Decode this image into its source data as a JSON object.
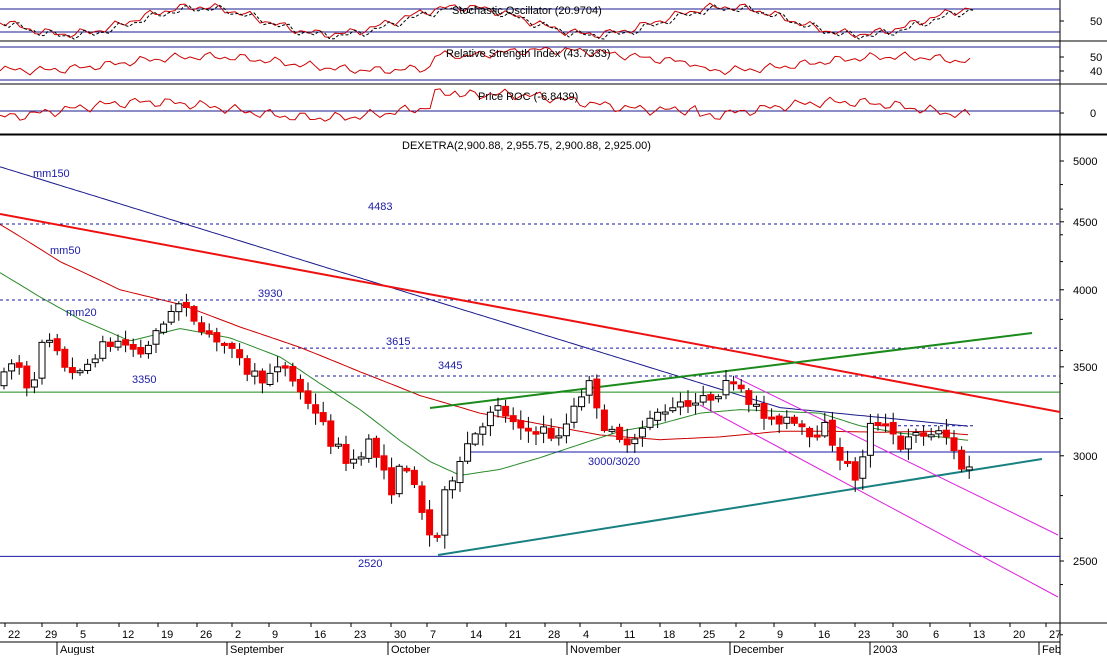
{
  "chart_data": {
    "type": "candlestick",
    "instrument": "DEXETRA",
    "price_scale": "log",
    "ohlc_header": "DEXETRA(2,900.88, 2,955.75, 2,900.88, 2,925.00)",
    "ohlc_last": {
      "open": 2900.88,
      "high": 2955.75,
      "low": 2900.88,
      "close": 2925.0
    },
    "price_axis": {
      "ticks": [
        "5000",
        "4500",
        "4000",
        "3500",
        "3000",
        "2500"
      ],
      "ylim": [
        2100,
        5300
      ]
    },
    "indicators": [
      {
        "name": "Stochastic Oscillator",
        "title": "Stochastic Oscillator (20.9704)",
        "value": 20.9704,
        "ticks": [
          "50"
        ],
        "ylim": [
          0,
          100
        ],
        "bands": [
          80,
          20
        ]
      },
      {
        "name": "Relative Strength Index",
        "title": "Relative Strength Index (43.7333)",
        "value": 43.7333,
        "ticks": [
          "50",
          "40"
        ],
        "ylim": [
          20,
          75
        ],
        "bands": [
          70,
          30
        ]
      },
      {
        "name": "Price ROC",
        "title": "Price ROC (-6.8439)",
        "value": -6.8439,
        "ticks": [
          "0"
        ],
        "ylim": [
          -20,
          20
        ],
        "bands": [
          0
        ]
      }
    ],
    "x_axis": {
      "day_labels": [
        "22",
        "29",
        "5",
        "12",
        "19",
        "26",
        "2",
        "9",
        "16",
        "23",
        "30",
        "7",
        "14",
        "21",
        "28",
        "4",
        "11",
        "18",
        "25",
        "2",
        "9",
        "16",
        "23",
        "30",
        "6",
        "13",
        "20",
        "27",
        "3"
      ],
      "month_labels": [
        "August",
        "September",
        "October",
        "November",
        "December",
        "2003",
        "Feb"
      ]
    },
    "moving_averages": [
      {
        "name": "mm150",
        "label": "mm150",
        "color": "#1a1a8c"
      },
      {
        "name": "mm50",
        "label": "mm50",
        "color": "#cc0000"
      },
      {
        "name": "mm20",
        "label": "mm20",
        "color": "#2a8a2a"
      }
    ],
    "annotations": [
      {
        "text": "4483",
        "level": 4483,
        "style": "dashed",
        "color": "#1a1aa6"
      },
      {
        "text": "3930",
        "level": 3930,
        "style": "dashed",
        "color": "#1a1aa6"
      },
      {
        "text": "3615",
        "level": 3615,
        "style": "dashed",
        "color": "#1a1aa6"
      },
      {
        "text": "3445",
        "level": 3445,
        "style": "dashed",
        "color": "#1a1aa6"
      },
      {
        "text": "3350",
        "level": 3350,
        "style": "solid",
        "color": "#1a8a1a"
      },
      {
        "text": "3000/3020",
        "level": 3020,
        "style": "solid",
        "color": "#1a1aa6"
      },
      {
        "text": "2520",
        "level": 2520,
        "style": "solid",
        "color": "#1a1aa6"
      }
    ],
    "colors": {
      "up": "#ffffff",
      "down": "#ee0000",
      "grid": "#000000",
      "background": "#ffffff"
    }
  }
}
